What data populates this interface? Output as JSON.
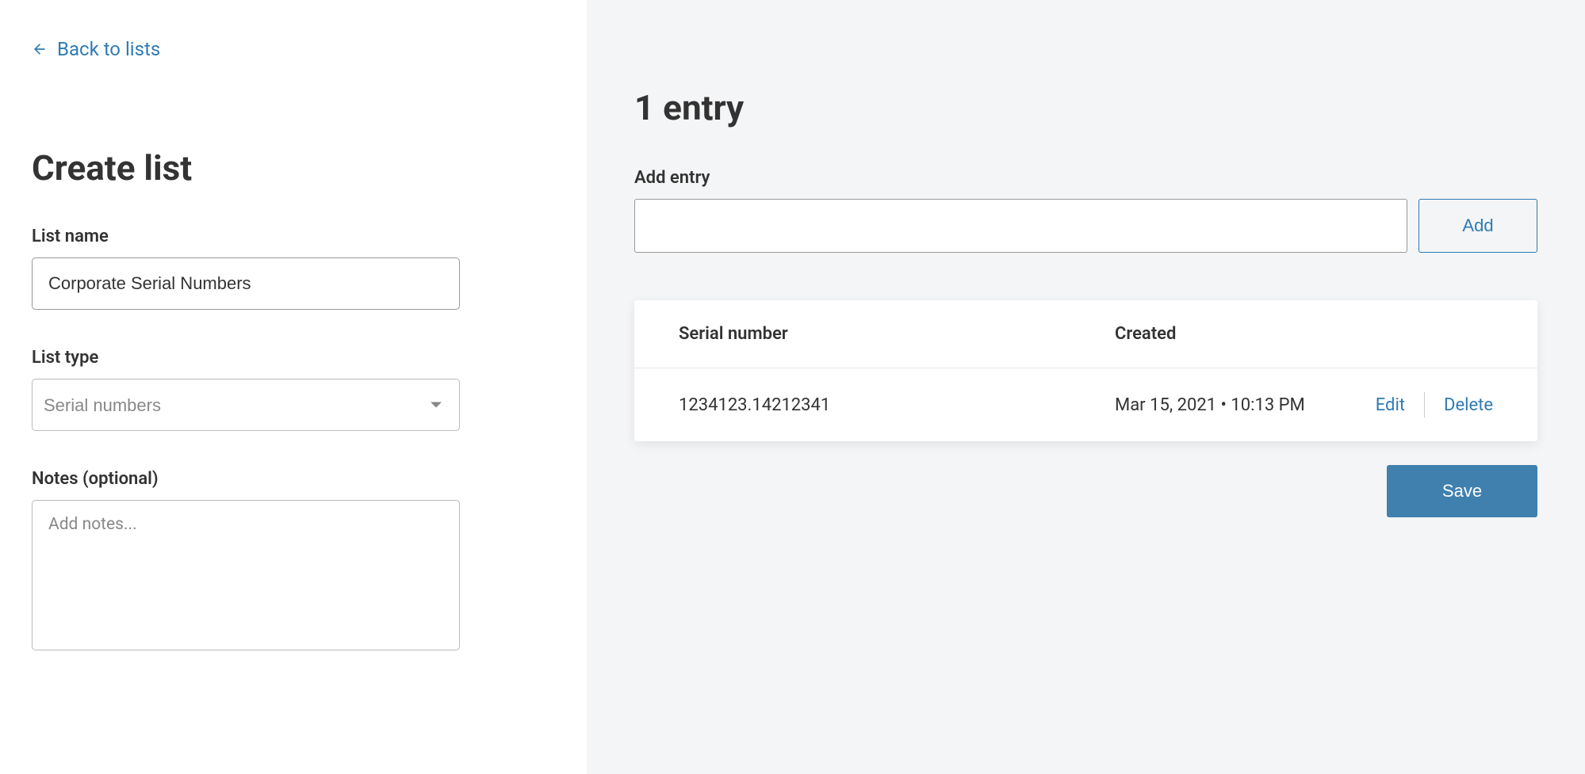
{
  "left": {
    "back_label": "Back to lists",
    "heading": "Create list",
    "list_name_label": "List name",
    "list_name_value": "Corporate Serial Numbers",
    "list_type_label": "List type",
    "list_type_value": "Serial numbers",
    "notes_label": "Notes (optional)",
    "notes_placeholder": "Add notes..."
  },
  "right": {
    "entries_heading": "1 entry",
    "add_entry_label": "Add entry",
    "add_button_label": "Add",
    "table": {
      "headers": {
        "serial": "Serial number",
        "created": "Created"
      },
      "rows": [
        {
          "serial": "1234123.14212341",
          "created": "Mar 15, 2021 • 10:13 PM"
        }
      ],
      "actions": {
        "edit": "Edit",
        "delete": "Delete"
      }
    },
    "save_label": "Save"
  }
}
